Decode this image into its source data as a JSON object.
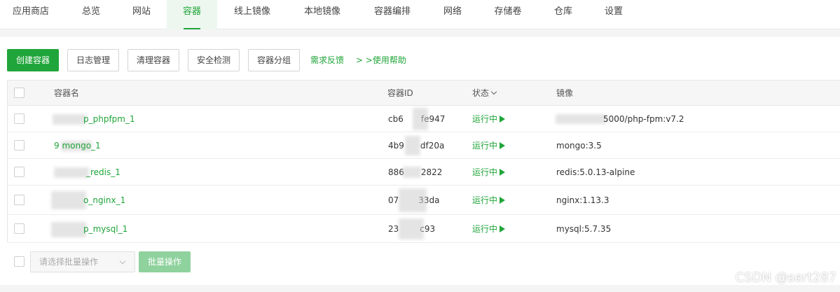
{
  "nav": {
    "items": [
      {
        "label": "应用商店"
      },
      {
        "label": "总览"
      },
      {
        "label": "网站"
      },
      {
        "label": "容器",
        "active": true
      },
      {
        "label": "线上镜像"
      },
      {
        "label": "本地镜像"
      },
      {
        "label": "容器编排"
      },
      {
        "label": "网络"
      },
      {
        "label": "存储卷"
      },
      {
        "label": "仓库"
      },
      {
        "label": "设置"
      }
    ]
  },
  "toolbar": {
    "create_label": "创建容器",
    "log_label": "日志管理",
    "clean_label": "清理容器",
    "security_label": "安全检测",
    "group_label": "容器分组",
    "feedback_link": "需求反馈",
    "help_link": "> >使用帮助"
  },
  "table": {
    "headers": {
      "name": "容器名",
      "id": "容器ID",
      "status": "状态",
      "image": "镜像"
    },
    "rows": [
      {
        "name": "p_phpfpm_1",
        "id_start": "cb6",
        "id_end": "fe947",
        "status": "运行中",
        "image": "5000/php-fpm:v7.2"
      },
      {
        "name": "9         mongo_1",
        "id_start": "4b9",
        "id_end": "df20a",
        "status": "运行中",
        "image": "mongo:3.5"
      },
      {
        "name": "_redis_1",
        "id_start": "886",
        "id_end": "2822",
        "status": "运行中",
        "image": "redis:5.0.13-alpine"
      },
      {
        "name": "o_nginx_1",
        "id_start": "07",
        "id_end": "33da",
        "status": "运行中",
        "image": "nginx:1.13.3"
      },
      {
        "name": "p_mysql_1",
        "id_start": "23",
        "id_end": "c93",
        "status": "运行中",
        "image": "mysql:5.7.35"
      }
    ]
  },
  "batch": {
    "select_placeholder": "请选择批量操作",
    "button_label": "批量操作"
  },
  "watermark": "CSDN @sert287",
  "colors": {
    "accent": "#20a53a",
    "accent_light": "#8fd29d"
  }
}
